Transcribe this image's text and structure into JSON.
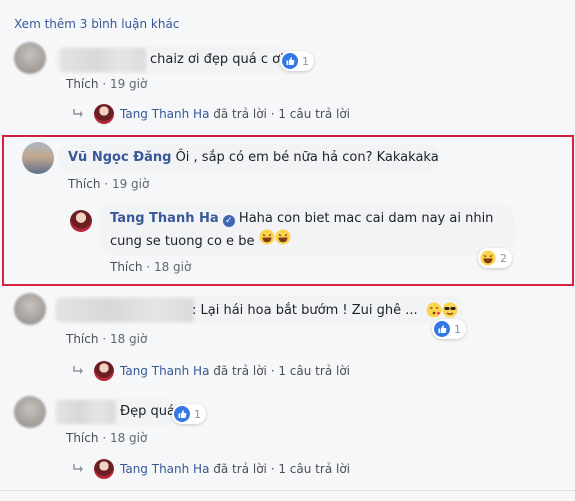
{
  "see_more": "Xem thêm 3 bình luận khác",
  "like_label": "Thích",
  "dot": "·",
  "comments": [
    {
      "text": "chaiz ơi đẹp quá c ơi",
      "reactions": "1",
      "time": "19 giờ",
      "reply": {
        "who": "Tang Thanh Ha",
        "action": "đã trả lời",
        "count": "1 câu trả lời"
      }
    },
    {
      "name": "Vũ Ngọc Đăng",
      "text": "Ôi , sắp có em bé nữa hả con? Kakakaka",
      "time": "19 giờ",
      "reply_comment": {
        "name": "Tang Thanh Ha",
        "text_line1": "Haha con biet mac cai dam nay ai nhin",
        "text_line2": "cung se tuong co e be",
        "reactions": "2",
        "time": "18 giờ"
      }
    },
    {
      "text": ": Lại hái hoa bắt bướm ! Zui ghê ...",
      "reactions": "1",
      "time": "18 giờ",
      "reply": {
        "who": "Tang Thanh Ha",
        "action": "đã trả lời",
        "count": "1 câu trả lời"
      }
    },
    {
      "text": "Đẹp quá",
      "reactions": "1",
      "time": "18 giờ",
      "reply": {
        "who": "Tang Thanh Ha",
        "action": "đã trả lời",
        "count": "1 câu trả lời"
      }
    }
  ],
  "icons": {
    "like": "like-icon",
    "laugh": "laugh-emoji-icon",
    "kiss": "kiss-emoji-icon",
    "cool": "sunglasses-emoji-icon",
    "reply": "reply-arrow-icon",
    "verified": "verified-badge-icon"
  },
  "colors": {
    "link": "#365899",
    "name": "#385898",
    "highlight": "#d1233f",
    "like": "#3578e5"
  }
}
